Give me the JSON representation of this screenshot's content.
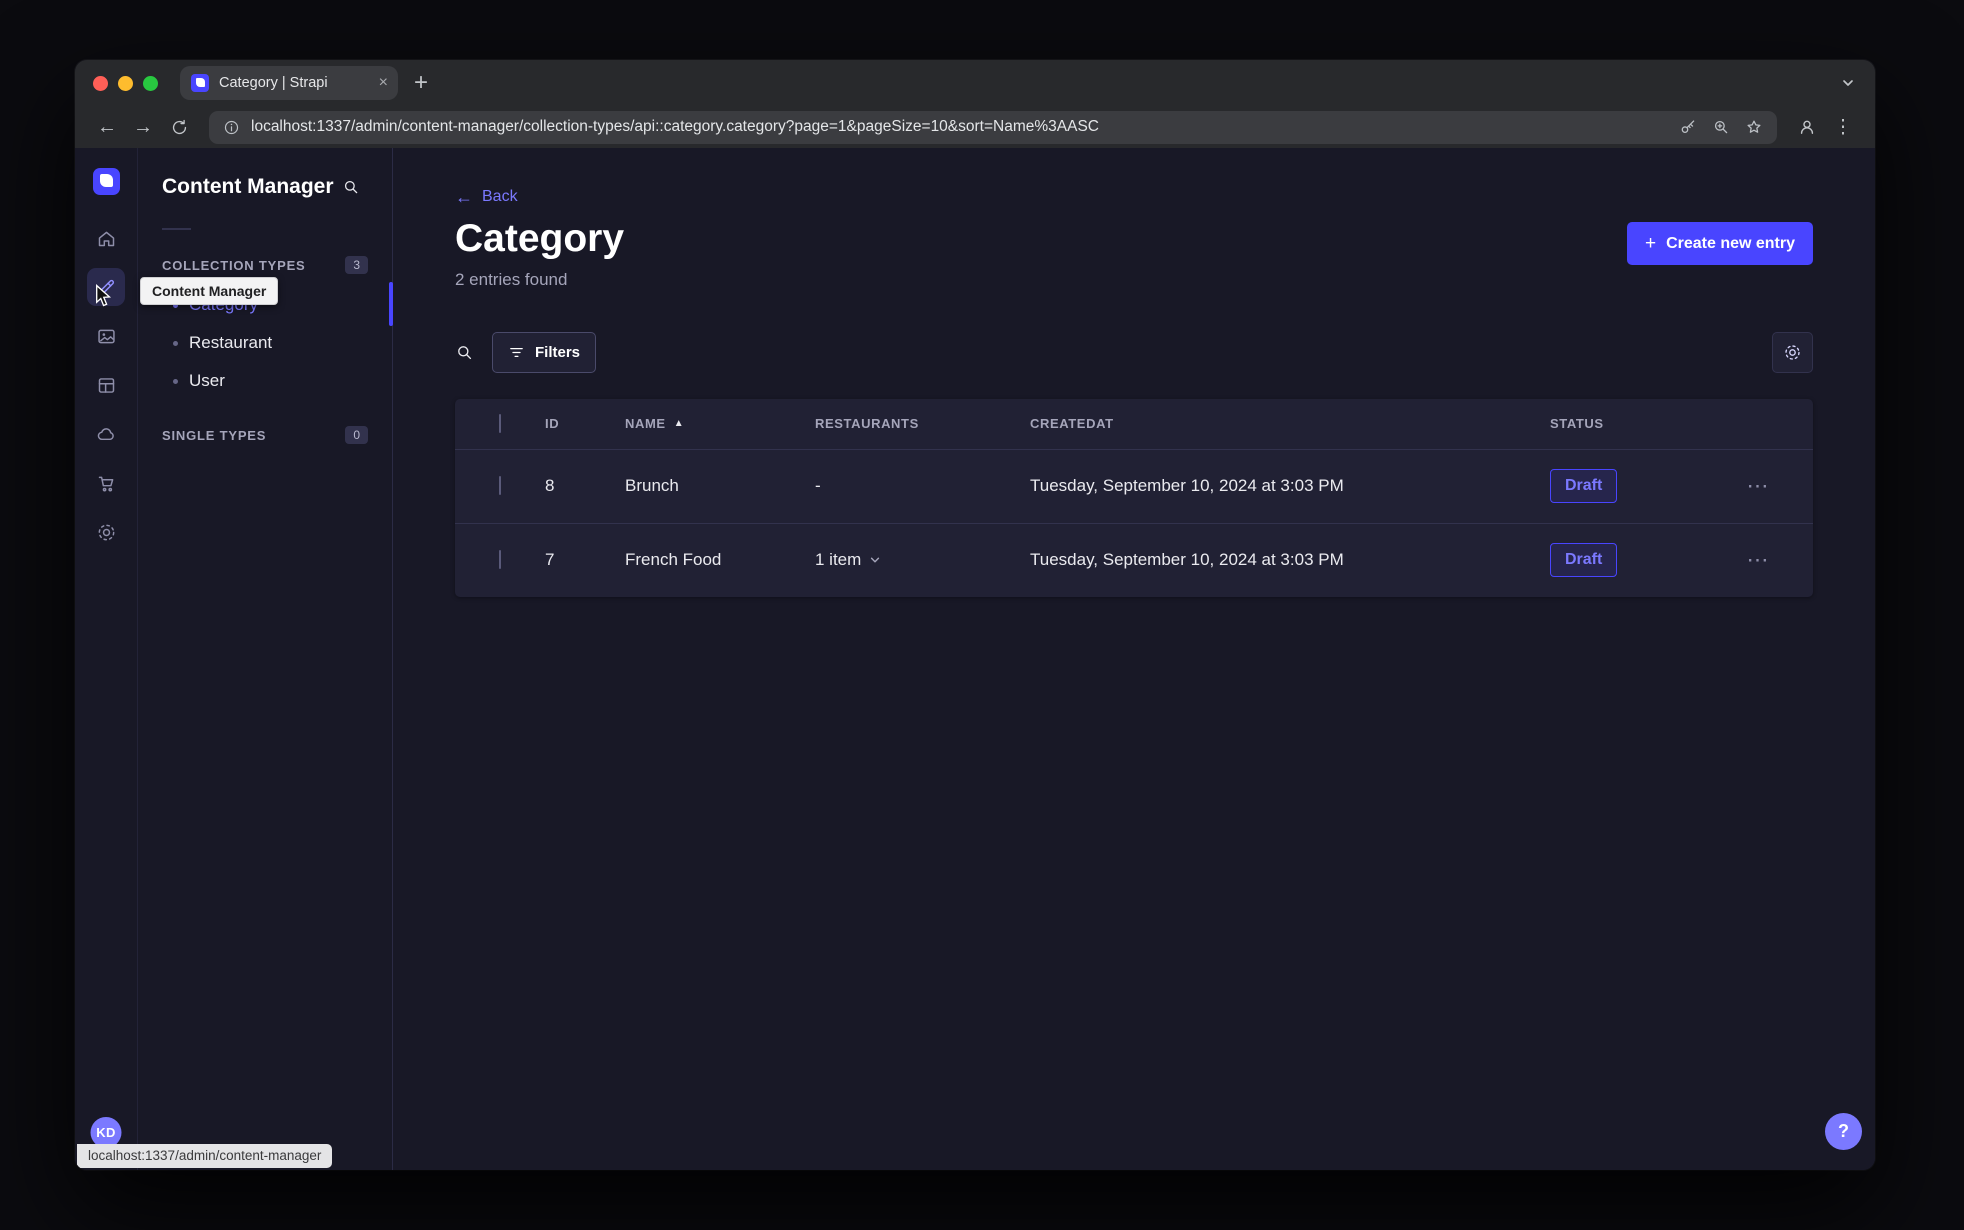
{
  "browser": {
    "tab_title": "Category | Strapi",
    "url": "localhost:1337/admin/content-manager/collection-types/api::category.category?page=1&pageSize=10&sort=Name%3AASC",
    "status_bubble": "localhost:1337/admin/content-manager"
  },
  "rail": {
    "tooltip": "Content Manager",
    "avatar_initials": "KD",
    "icons": [
      "home-icon",
      "content-manager-icon",
      "media-library-icon",
      "content-type-builder-icon",
      "cloud-icon",
      "marketplace-icon",
      "settings-icon"
    ]
  },
  "subnav": {
    "title": "Content Manager",
    "collection_types": {
      "label": "COLLECTION TYPES",
      "count": "3"
    },
    "items": [
      {
        "label": "Category",
        "active": true
      },
      {
        "label": "Restaurant",
        "active": false
      },
      {
        "label": "User",
        "active": false
      }
    ],
    "single_types": {
      "label": "SINGLE TYPES",
      "count": "0"
    }
  },
  "main": {
    "back_label": "Back",
    "title": "Category",
    "subtitle": "2 entries found",
    "create_button": "Create new entry",
    "filters_label": "Filters",
    "help_label": "?"
  },
  "table": {
    "headers": {
      "id": "ID",
      "name": "NAME",
      "restaurants": "RESTAURANTS",
      "createdat": "CREATEDAT",
      "status": "STATUS"
    },
    "rows": [
      {
        "id": "8",
        "name": "Brunch",
        "restaurants": "-",
        "createdat": "Tuesday, September 10, 2024 at 3:03 PM",
        "status": "Draft"
      },
      {
        "id": "7",
        "name": "French Food",
        "restaurants": "1 item",
        "createdat": "Tuesday, September 10, 2024 at 3:03 PM",
        "status": "Draft"
      }
    ]
  },
  "colors": {
    "primary": "#4945ff",
    "primary_light": "#7b79ff",
    "app_background": "#181826",
    "card_background": "#212134",
    "border": "#32324d",
    "text_muted": "#a5a5ba"
  }
}
